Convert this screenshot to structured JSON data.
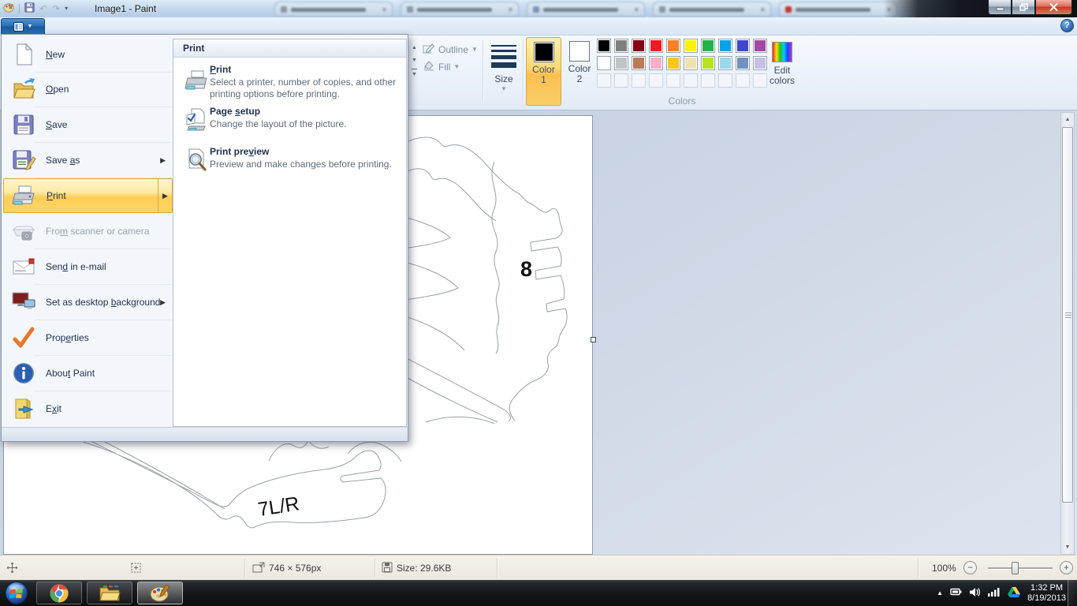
{
  "window": {
    "title": "Image1 - Paint"
  },
  "titlebar": {
    "tabs": [
      {
        "favicon": "#8a97a6"
      },
      {
        "favicon": "#8a97a6"
      },
      {
        "favicon": "#7d93b0"
      },
      {
        "favicon": "#8a97a6"
      },
      {
        "favicon": "#c0392b"
      }
    ]
  },
  "ribbon": {
    "outline_label": "Outline",
    "fill_label": "Fill",
    "size_label": "Size",
    "color1_line1": "Color",
    "color1_line2": "1",
    "color2_line1": "Color",
    "color2_line2": "2",
    "edit_colors_line1": "Edit",
    "edit_colors_line2": "colors",
    "colors_group_label": "Colors",
    "color1_value": "#000000",
    "color2_value": "#FFFFFF",
    "palette_row1": [
      "#000000",
      "#7F7F7F",
      "#880015",
      "#ED1C24",
      "#FF7F27",
      "#FFF200",
      "#22B14C",
      "#00A2E8",
      "#3F48CC",
      "#A349A4"
    ],
    "palette_row2": [
      "#FFFFFF",
      "#C3C3C3",
      "#B97A57",
      "#FFAEC9",
      "#FFC90E",
      "#EFE4B0",
      "#B5E61D",
      "#99D9EA",
      "#7092BE",
      "#C8BFE7"
    ],
    "help_glyph": "?"
  },
  "file_menu": {
    "items": [
      {
        "pre": "",
        "key": "N",
        "post": "ew"
      },
      {
        "pre": "",
        "key": "O",
        "post": "pen"
      },
      {
        "pre": "",
        "key": "S",
        "post": "ave"
      },
      {
        "pre": "Save ",
        "key": "a",
        "post": "s"
      },
      {
        "pre": "",
        "key": "P",
        "post": "rint"
      },
      {
        "pre": "Fro",
        "key": "m",
        "post": " scanner or camera"
      },
      {
        "pre": "Sen",
        "key": "d",
        "post": " in e-mail"
      },
      {
        "pre": "Set as desktop ",
        "key": "b",
        "post": "ackground"
      },
      {
        "pre": "Prop",
        "key": "e",
        "post": "rties"
      },
      {
        "pre": "Abou",
        "key": "t",
        "post": " Paint"
      },
      {
        "pre": "E",
        "key": "x",
        "post": "it"
      }
    ]
  },
  "print_submenu": {
    "header": "Print",
    "items": [
      {
        "pre": "",
        "key": "P",
        "post": "rint",
        "desc": "Select a printer, number of copies, and other printing options before printing."
      },
      {
        "pre": "Page ",
        "key": "s",
        "post": "etup",
        "desc": "Change the layout of the picture."
      },
      {
        "pre": "Print pre",
        "key": "v",
        "post": "iew",
        "desc": "Preview and make changes before printing."
      }
    ]
  },
  "canvas": {
    "piece_label_top": "8",
    "piece_label_bottom": "7L/R"
  },
  "statusbar": {
    "dimensions": "746 × 576px",
    "file_size": "Size: 29.6KB",
    "zoom_level": "100%"
  },
  "taskbar": {
    "time": "1:32 PM",
    "date": "8/19/2013"
  }
}
